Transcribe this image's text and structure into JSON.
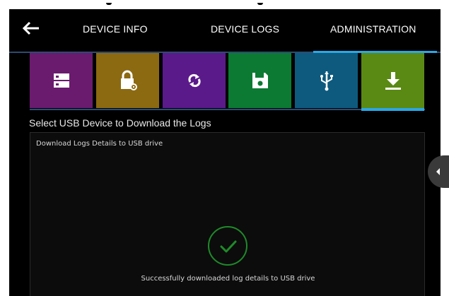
{
  "header": {
    "back_icon": "arrow-left-icon",
    "tabs": [
      {
        "label": "DEVICE INFO",
        "active": false
      },
      {
        "label": "DEVICE LOGS",
        "active": false
      },
      {
        "label": "ADMINISTRATION",
        "active": true
      }
    ]
  },
  "tiles": [
    {
      "icon": "server-icon",
      "color": "#6a1b6e"
    },
    {
      "icon": "lock-settings-icon",
      "color": "#8c6a12"
    },
    {
      "icon": "refresh-icon",
      "color": "#5b1a8a"
    },
    {
      "icon": "save-icon",
      "color": "#0c7a32"
    },
    {
      "icon": "usb-icon",
      "color": "#0e5a7e"
    },
    {
      "icon": "download-icon",
      "color": "#5a8a14",
      "active": true
    }
  ],
  "main": {
    "section_title": "Select USB Device to Download the Logs",
    "panel_heading": "Download Logs Details to USB drive",
    "success_message": "Successfully downloaded log details to USB drive"
  },
  "colors": {
    "accent": "#2aa7e6",
    "success": "#1f8a2a"
  }
}
